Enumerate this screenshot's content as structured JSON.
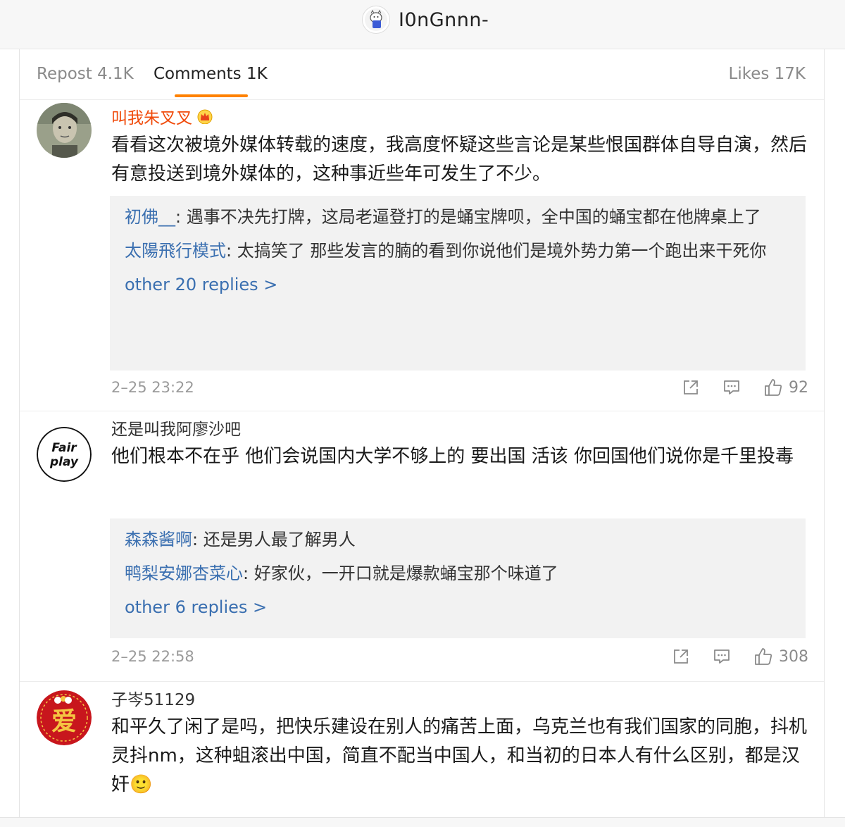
{
  "header": {
    "title": "I0nGnnn-"
  },
  "tabs": {
    "repost": "Repost 4.1K",
    "comments": "Comments 1K",
    "likes": "Likes 17K"
  },
  "colors": {
    "accent": "#ff8200",
    "link": "#3a6fb0",
    "vip_name": "#f04a0a"
  },
  "comments": [
    {
      "user": "叫我朱叉叉",
      "text": "看看这次被境外媒体转载的速度，我高度怀疑这些言论是某些恨国群体自导自演，然后有意投送到境外媒体的，这种事近些年可发生了不少。",
      "replies": [
        {
          "user": "初佛__",
          "text": ": 遇事不决先打牌，这局老逼登打的是蛹宝牌呗，全中国的蛹宝都在他牌桌上了"
        },
        {
          "user": "太陽飛行模式",
          "text": ": 太搞笑了 那些发言的腩的看到你说他们是境外势力第一个跑出来干死你"
        }
      ],
      "more": "other 20 replies >",
      "time": "2–25 23:22",
      "likes": "92",
      "icons": [
        "repost-icon",
        "comment-icon",
        "like-icon"
      ]
    },
    {
      "user": "还是叫我阿廖沙吧",
      "avatar_text": [
        "Fair",
        "play"
      ],
      "text": "他们根本不在乎 他们会说国内大学不够上的 要出国 活该 你回国他们说你是千里投毒",
      "replies": [
        {
          "user": "森森酱啊",
          "text": ": 还是男人最了解男人"
        },
        {
          "user": "鸭梨安娜杏菜心",
          "text": ": 好家伙，一开口就是爆款蛹宝那个味道了"
        }
      ],
      "more": "other 6 replies >",
      "time": "2–25 22:58",
      "likes": "308"
    },
    {
      "user": "子岑51129",
      "avatar_text": "爱",
      "text": "和平久了闲了是吗，把快乐建设在别人的痛苦上面，乌克兰也有我们国家的同胞，抖机灵抖nm，这种蛆滚出中国，简直不配当中国人，和当初的日本人有什么区别，都是汉奸🙂"
    }
  ]
}
